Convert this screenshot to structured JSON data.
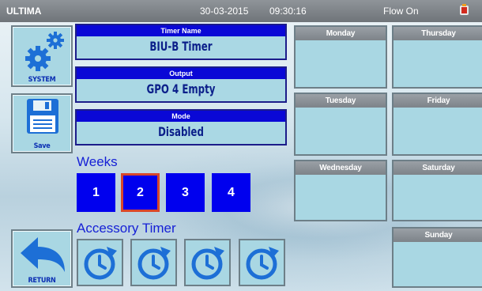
{
  "status_bar": {
    "title": "ULTIMA",
    "date": "30-03-2015",
    "time": "09:30:16",
    "flow_status": "Flow On",
    "alarm_icon": "alarm-icon"
  },
  "left_buttons": {
    "system_label": "SYSTEM",
    "save_label": "Save",
    "return_label": "RETURN"
  },
  "fields": {
    "timer_name": {
      "label": "Timer Name",
      "value": "BIU-B Timer"
    },
    "output": {
      "label": "Output",
      "value": "GPO 4 Empty"
    },
    "mode": {
      "label": "Mode",
      "value": "Disabled"
    }
  },
  "weeks": {
    "label": "Weeks",
    "items": [
      "1",
      "2",
      "3",
      "4"
    ],
    "selected": "2"
  },
  "accessory_timer": {
    "label": "Accessory Timer",
    "icons": [
      "clock-icon",
      "clock-icon",
      "clock-icon",
      "clock-icon"
    ]
  },
  "days": {
    "monday": "Monday",
    "tuesday": "Tuesday",
    "wednesday": "Wednesday",
    "thursday": "Thursday",
    "friday": "Friday",
    "saturday": "Saturday",
    "sunday": "Sunday"
  },
  "colors": {
    "accent_blue": "#0000ee",
    "label_blue": "#1620d6",
    "tile_fill": "#a9d7e3",
    "selected_border": "#d9472a"
  }
}
